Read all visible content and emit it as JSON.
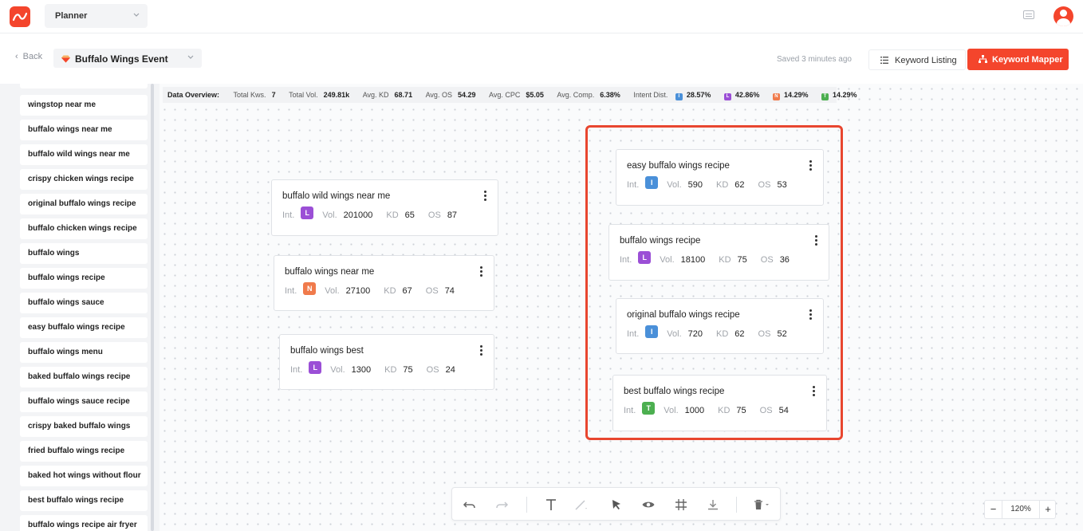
{
  "colors": {
    "accent": "#f4452c",
    "intent_i": "#4a90d9",
    "intent_l": "#9b4fd6",
    "intent_n": "#f07a4b",
    "intent_t": "#4caf50"
  },
  "header": {
    "planner": "Planner"
  },
  "subheader": {
    "back": "Back",
    "event": "Buffalo Wings Event",
    "saved": "Saved 3 minutes ago",
    "keyword_listing": "Keyword Listing",
    "keyword_mapper": "Keyword Mapper"
  },
  "sidebar": {
    "items": [
      "wingstop near me",
      "buffalo wings near me",
      "buffalo wild wings near me",
      "crispy chicken wings recipe",
      "original buffalo wings recipe",
      "buffalo chicken wings recipe",
      "buffalo wings",
      "buffalo wings recipe",
      "buffalo wings sauce",
      "easy buffalo wings recipe",
      "buffalo wings menu",
      "baked buffalo wings recipe",
      "buffalo wings sauce recipe",
      "crispy baked buffalo wings",
      "fried buffalo wings recipe",
      "baked hot wings without flour",
      "best buffalo wings recipe",
      "buffalo wings recipe air fryer"
    ]
  },
  "overview": {
    "title": "Data Overview:",
    "total_kws_label": "Total Kws.",
    "total_kws": "7",
    "total_vol_label": "Total Vol.",
    "total_vol": "249.81k",
    "avg_kd_label": "Avg. KD",
    "avg_kd": "68.71",
    "avg_os_label": "Avg. OS",
    "avg_os": "54.29",
    "avg_cpc_label": "Avg. CPC",
    "avg_cpc": "$5.05",
    "avg_comp_label": "Avg. Comp.",
    "avg_comp": "6.38%",
    "intent_label": "Intent Dist.",
    "intents": [
      {
        "letter": "I",
        "pct": "28.57%"
      },
      {
        "letter": "L",
        "pct": "42.86%"
      },
      {
        "letter": "N",
        "pct": "14.29%"
      },
      {
        "letter": "T",
        "pct": "14.29%"
      }
    ]
  },
  "card_labels": {
    "int": "Int.",
    "vol": "Vol.",
    "kd": "KD",
    "os": "OS"
  },
  "cards": [
    {
      "keyword": "buffalo wild wings near me",
      "intent": "L",
      "vol": "201000",
      "kd": "65",
      "os": "87"
    },
    {
      "keyword": "buffalo wings near me",
      "intent": "N",
      "vol": "27100",
      "kd": "67",
      "os": "74"
    },
    {
      "keyword": "buffalo wings best",
      "intent": "L",
      "vol": "1300",
      "kd": "75",
      "os": "24"
    },
    {
      "keyword": "easy buffalo wings recipe",
      "intent": "I",
      "vol": "590",
      "kd": "62",
      "os": "53"
    },
    {
      "keyword": "buffalo wings recipe",
      "intent": "L",
      "vol": "18100",
      "kd": "75",
      "os": "36"
    },
    {
      "keyword": "original buffalo wings recipe",
      "intent": "I",
      "vol": "720",
      "kd": "62",
      "os": "52"
    },
    {
      "keyword": "best buffalo wings recipe",
      "intent": "T",
      "vol": "1000",
      "kd": "75",
      "os": "54"
    }
  ],
  "toolbar": {
    "icons": [
      "undo-icon",
      "redo-icon",
      "text-icon",
      "line-icon",
      "pointer-icon",
      "eye-icon",
      "grid-icon",
      "download-icon",
      "trash-icon"
    ]
  },
  "zoom": {
    "minus": "−",
    "value": "120%",
    "plus": "+"
  }
}
